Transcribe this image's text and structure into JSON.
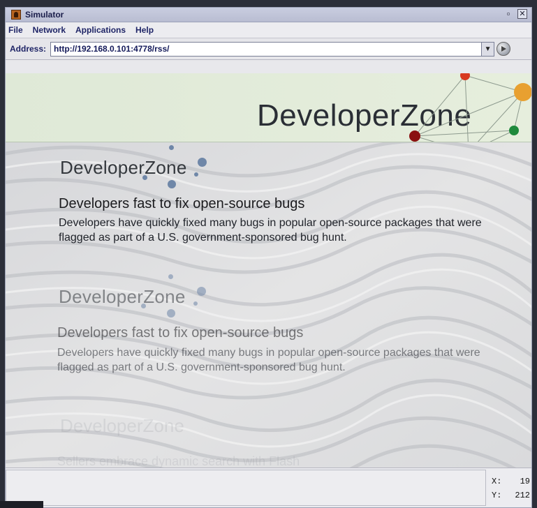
{
  "window": {
    "title": "Simulator",
    "icon": "java-duke-icon",
    "controls": {
      "restore": "restore-icon",
      "close": "close-icon"
    }
  },
  "menu": [
    "File",
    "Network",
    "Applications",
    "Help"
  ],
  "address": {
    "label": "Address:",
    "value": "http://192.168.0.101:4778/rss/"
  },
  "page": {
    "header_logo": "DeveloperZone",
    "items": [
      {
        "logo": "DeveloperZone",
        "headline": "Developers fast to fix open-source bugs",
        "body": "Developers have quickly fixed many bugs in popular open-source packages that were flagged as part of a U.S. government-sponsored bug hunt."
      },
      {
        "logo": "DeveloperZone",
        "headline": "Developers fast to fix open-source bugs",
        "body": "Developers have quickly fixed many bugs in popular open-source packages that were flagged as part of a U.S. government-sponsored bug hunt."
      },
      {
        "logo": "DeveloperZone",
        "headline": "Sellers embrace dynamic search with Flash",
        "body": ""
      }
    ]
  },
  "status": {
    "x_label": "X:",
    "x_value": "19",
    "y_label": "Y:",
    "y_value": "212"
  },
  "colors": {
    "dot_red": "#d8381f",
    "dot_orange": "#e8a030",
    "dot_green": "#1f8a3c",
    "dot_blue": "#1f4db0",
    "dot_darkred": "#8a1010",
    "dot_grey_blue": "#6f87a8"
  }
}
